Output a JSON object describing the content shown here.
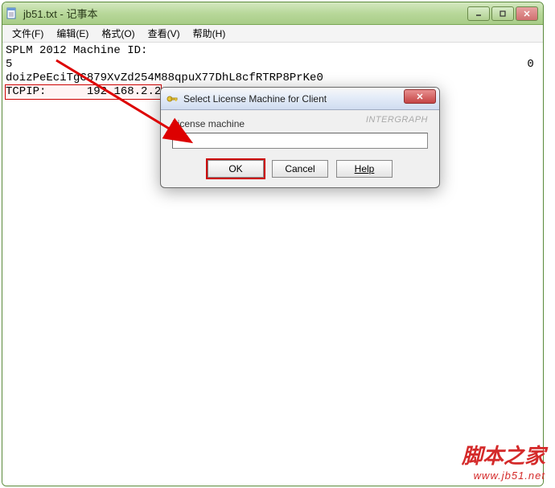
{
  "window": {
    "title": "jb51.txt - 记事本",
    "menu": {
      "file": "文件(F)",
      "edit": "编辑(E)",
      "format": "格式(O)",
      "view": "查看(V)",
      "help": "帮助(H)"
    }
  },
  "notepad": {
    "line1": "SPLM 2012 Machine ID:",
    "line2_start": "5",
    "line2_end": "0",
    "line3": "doizPeEciTgC879XvZd254M88qpuX77DhL8cfRTRP8PrKe0",
    "line4_label": "TCPIP:",
    "line4_value": "192.168.2.2"
  },
  "dialog": {
    "title": "Select License Machine for Client",
    "brand": "INTERGRAPH",
    "label": "License machine",
    "input_value": "",
    "buttons": {
      "ok": "OK",
      "cancel": "Cancel",
      "help": "Help"
    }
  },
  "watermark": {
    "cn": "脚本之家",
    "en": "www.jb51.net"
  }
}
